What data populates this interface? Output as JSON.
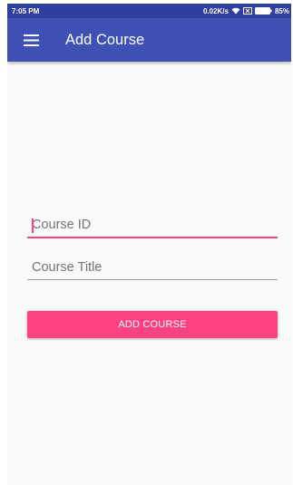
{
  "status_bar": {
    "time": "7:05 PM",
    "network_speed": "0.02K/s",
    "battery": "85%",
    "icons": [
      "wifi-icon",
      "sim-icon",
      "battery-icon"
    ]
  },
  "app_bar": {
    "title": "Add Course",
    "menu_icon": "hamburger-menu-icon",
    "color": "#3f51b5"
  },
  "form": {
    "course_id": {
      "value": "",
      "placeholder": "Course ID",
      "focused": true
    },
    "course_title": {
      "value": "",
      "placeholder": "Course Title"
    },
    "submit_label": "ADD COURSE"
  },
  "colors": {
    "primary": "#3f51b5",
    "primary_dark": "#303f9f",
    "accent": "#ff4081"
  }
}
